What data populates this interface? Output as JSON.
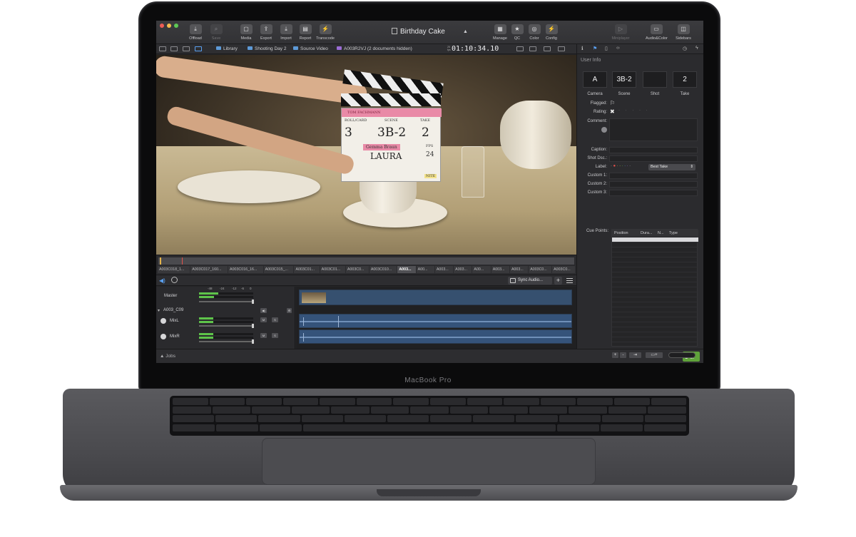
{
  "laptop": {
    "brand": "MacBook Pro"
  },
  "toolbar": {
    "offload": "Offload",
    "save": "Save",
    "media": "Media",
    "export": "Export",
    "import": "Import",
    "report": "Report",
    "transcode": "Transcode",
    "doc_title": "Birthday Cake",
    "manage": "Manage",
    "qc": "QC",
    "color": "Color",
    "config": "Config",
    "miniplayer": "Miniplayer",
    "audio_color": "Audio&Color",
    "sidebars": "Sidebars"
  },
  "pathbar": {
    "library": "Library",
    "day": "Shooting Day 2",
    "source": "Source Video",
    "clip": "A003R2VJ (2 documents hidden)",
    "tc_label_top": "25",
    "tc_label_bottom": "fps",
    "timecode": "01:10:34.10"
  },
  "slate": {
    "production": "TOM FACHMANN",
    "roll_label": "ROLL/CARD",
    "scene_label": "SCENE",
    "take_label": "TAKE",
    "roll": "3",
    "scene": "3B-2",
    "take": "2",
    "director": "Gemma Braun",
    "cam_op": "LAURA",
    "fps_label": "FPS",
    "fps": "24",
    "nite": "NITE"
  },
  "thumbnails": [
    "A003C018_1...",
    "A003C017_160...",
    "A003C016_16...",
    "A003C015_...",
    "A003C01...",
    "A003C01...",
    "A003C0...",
    "A003C010...",
    "A003...",
    "A00...",
    "A003...",
    "A003...",
    "A00...",
    "A003...",
    "A003...",
    "A003C0...",
    "A003C0..."
  ],
  "thumb_selected_index": 8,
  "audio": {
    "sync_label": "Sync Audio...",
    "master": "Master",
    "group": "A003_C09",
    "track1": "MixL",
    "track2": "MixR",
    "scale": [
      "-48",
      "-24",
      "-12",
      "-6",
      "0"
    ],
    "mute": "M",
    "solo": "S"
  },
  "status": {
    "jobs": "Jobs",
    "ok_count": "9",
    "ok_label": "ok"
  },
  "inspector": {
    "section": "User Info",
    "camera_value": "A",
    "scene_value": "3B-2",
    "shot_value": "",
    "take_value": "2",
    "camera_label": "Camera",
    "scene_label": "Scene",
    "shot_label": "Shot",
    "take_label": "Take",
    "flagged": "Flagged:",
    "rating": "Rating:",
    "comment": "Comment:",
    "caption": "Caption:",
    "shot_desc": "Shot Dsc.:",
    "label": "Label:",
    "label_value": "Best Take",
    "custom1": "Custom 1:",
    "custom2": "Custom 2:",
    "custom3": "Custom 3:",
    "cue_points": "Cue Points:",
    "cue_position": "Position",
    "cue_duration": "Dura...",
    "cue_n": "N...",
    "cue_type": "Type"
  },
  "colors": {
    "accent": "#5aa0f0",
    "ok_green": "#5fa33a",
    "meter_green": "#5ec44a",
    "label_red": "#e0504a"
  }
}
